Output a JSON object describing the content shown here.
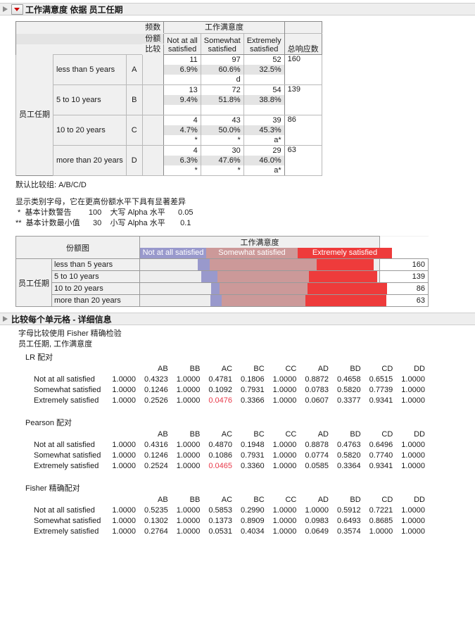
{
  "sections": {
    "main_title": "工作满意度 依据 员工任期",
    "detail_title": "比较每个单元格 - 详细信息"
  },
  "contingency": {
    "legend": [
      "频数",
      "份额",
      "比较"
    ],
    "col_group_label": "工作满意度",
    "row_var_label": "员工任期",
    "columns": [
      "Not at all satisfied",
      "Somewhat satisfied",
      "Extremely satisfied"
    ],
    "total_header": "总响应数",
    "rows": [
      {
        "label": "less than 5 years",
        "letter": "A",
        "counts": [
          "11",
          "97",
          "52"
        ],
        "shares": [
          "6.9%",
          "60.6%",
          "32.5%"
        ],
        "compare": [
          "",
          "d",
          ""
        ],
        "total": "160"
      },
      {
        "label": "5 to 10 years",
        "letter": "B",
        "counts": [
          "13",
          "72",
          "54"
        ],
        "shares": [
          "9.4%",
          "51.8%",
          "38.8%"
        ],
        "compare": [
          "",
          "",
          ""
        ],
        "total": "139"
      },
      {
        "label": "10 to 20 years",
        "letter": "C",
        "counts": [
          "4",
          "43",
          "39"
        ],
        "shares": [
          "4.7%",
          "50.0%",
          "45.3%"
        ],
        "compare": [
          "*",
          "*",
          "a*"
        ],
        "total": "86"
      },
      {
        "label": "more than 20 years",
        "letter": "D",
        "counts": [
          "4",
          "30",
          "29"
        ],
        "shares": [
          "6.3%",
          "47.6%",
          "46.0%"
        ],
        "compare": [
          "*",
          "*",
          "a*"
        ],
        "total": "63"
      }
    ]
  },
  "notes": {
    "default_group": "默认比较组: A/B/C/D",
    "legend_line": "显示类别字母，它在更高份额水平下具有显著差异",
    "line1": " *  基本计数警告        100    大写 Alpha 水平      0.05",
    "line2": "**  基本计数最小值      30    小写 Alpha 水平       0.1"
  },
  "share_chart": {
    "title": "份额图",
    "col_group_label": "工作满意度",
    "row_var_label": "员工任期",
    "keys": [
      {
        "label": "Not at all satisfied",
        "color": "#9999cc"
      },
      {
        "label": "Somewhat satisfied",
        "color": "#cc9999"
      },
      {
        "label": "Extremely satisfied",
        "color": "#ee3b3b"
      }
    ],
    "rows": [
      {
        "label": "less than 5 years",
        "shares": [
          6.9,
          60.6,
          32.5
        ],
        "total": "160"
      },
      {
        "label": "5 to 10 years",
        "shares": [
          9.4,
          51.8,
          38.8
        ],
        "total": "139"
      },
      {
        "label": "10 to 20 years",
        "shares": [
          4.7,
          50.0,
          45.3
        ],
        "total": "86"
      },
      {
        "label": "more than 20 years",
        "shares": [
          6.3,
          47.6,
          46.0
        ],
        "total": "63"
      }
    ]
  },
  "detail": {
    "method_line": "字母比较使用 Fisher 精确检验",
    "vars_line": "员工任期, 工作满意度",
    "col_headers": [
      "",
      "AB",
      "BB",
      "AC",
      "BC",
      "CC",
      "AD",
      "BD",
      "CD",
      "DD"
    ],
    "row_labels": [
      "Not at all satisfied",
      "Somewhat satisfied",
      "Extremely satisfied"
    ],
    "tables": [
      {
        "caption": "LR 配对",
        "rows": [
          [
            "1.0000",
            "0.4323",
            "1.0000",
            "0.4781",
            "0.1806",
            "1.0000",
            "0.8872",
            "0.4658",
            "0.6515",
            "1.0000"
          ],
          [
            "1.0000",
            "0.1246",
            "1.0000",
            "0.1092",
            "0.7931",
            "1.0000",
            "0.0783",
            "0.5820",
            "0.7739",
            "1.0000"
          ],
          [
            "1.0000",
            "0.2526",
            "1.0000",
            "0.0476",
            "0.3366",
            "1.0000",
            "0.0607",
            "0.3377",
            "0.9341",
            "1.0000"
          ]
        ],
        "highlight": [
          [
            2,
            3
          ]
        ]
      },
      {
        "caption": "Pearson 配对",
        "rows": [
          [
            "1.0000",
            "0.4316",
            "1.0000",
            "0.4870",
            "0.1948",
            "1.0000",
            "0.8878",
            "0.4763",
            "0.6496",
            "1.0000"
          ],
          [
            "1.0000",
            "0.1246",
            "1.0000",
            "0.1086",
            "0.7931",
            "1.0000",
            "0.0774",
            "0.5820",
            "0.7740",
            "1.0000"
          ],
          [
            "1.0000",
            "0.2524",
            "1.0000",
            "0.0465",
            "0.3360",
            "1.0000",
            "0.0585",
            "0.3364",
            "0.9341",
            "1.0000"
          ]
        ],
        "highlight": [
          [
            2,
            3
          ]
        ]
      },
      {
        "caption": "Fisher 精确配对",
        "rows": [
          [
            "1.0000",
            "0.5235",
            "1.0000",
            "0.5853",
            "0.2990",
            "1.0000",
            "1.0000",
            "0.5912",
            "0.7221",
            "1.0000"
          ],
          [
            "1.0000",
            "0.1302",
            "1.0000",
            "0.1373",
            "0.8909",
            "1.0000",
            "0.0983",
            "0.6493",
            "0.8685",
            "1.0000"
          ],
          [
            "1.0000",
            "0.2764",
            "1.0000",
            "0.0531",
            "0.4034",
            "1.0000",
            "0.0649",
            "0.3574",
            "1.0000",
            "1.0000"
          ]
        ],
        "highlight": []
      }
    ]
  },
  "colors": {
    "highlight": "#e8394a",
    "key1": "#9999cc",
    "key2": "#cc9999",
    "key3": "#ee3b3b"
  }
}
